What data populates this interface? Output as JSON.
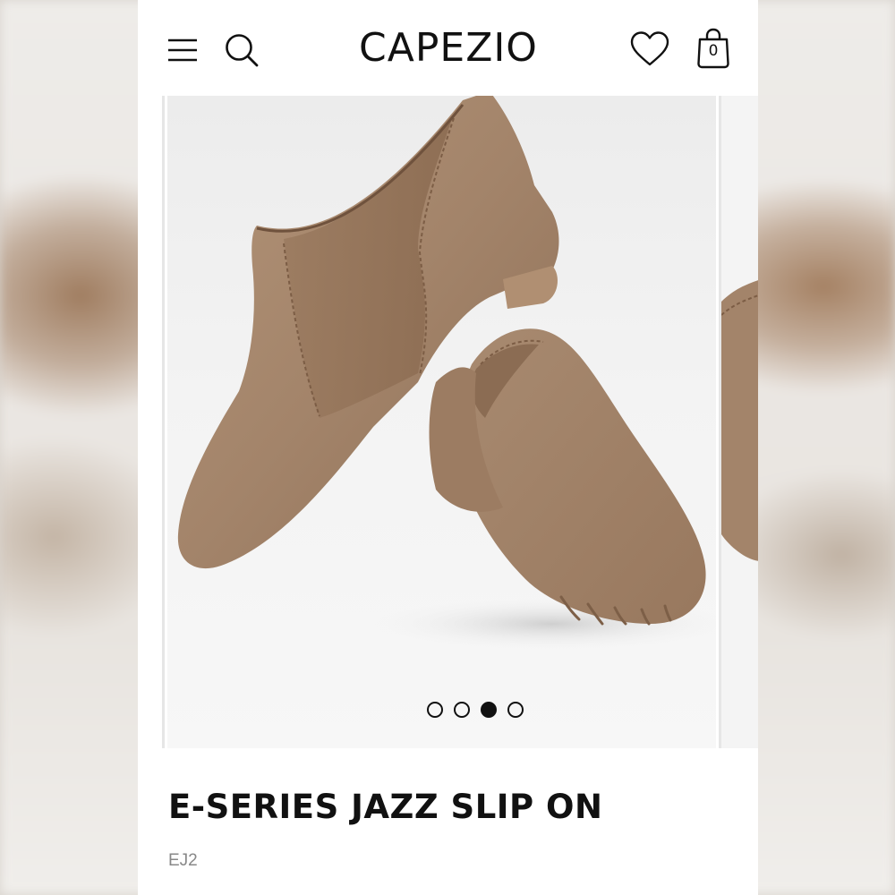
{
  "header": {
    "logo_text": "CAPEZIO",
    "menu_icon": "hamburger-menu-icon",
    "search_icon": "search-icon",
    "wishlist_icon": "heart-icon",
    "bag_icon": "shopping-bag-icon",
    "bag_count": "0"
  },
  "gallery": {
    "image_subject": "tan leather jazz slip-on shoes",
    "slide_count": 4,
    "active_slide": 3,
    "dots": [
      {
        "active": false
      },
      {
        "active": false
      },
      {
        "active": true
      },
      {
        "active": false
      }
    ]
  },
  "product": {
    "title": "E-SERIES JAZZ SLIP ON",
    "sku": "EJ2"
  },
  "colors": {
    "shoe": "#a3846a",
    "text": "#111111",
    "muted": "#888888"
  }
}
